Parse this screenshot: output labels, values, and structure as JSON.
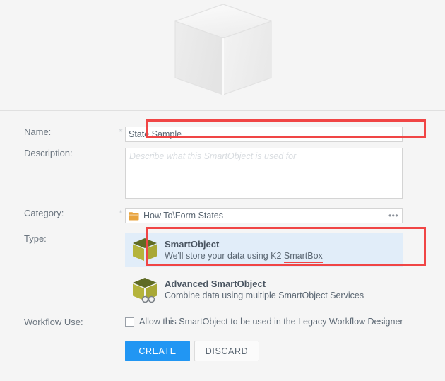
{
  "hero": {
    "icon": "smartobject-cube-icon"
  },
  "form": {
    "name": {
      "label": "Name:",
      "required_marker": "*",
      "value": "State Sample",
      "placeholder": ""
    },
    "description": {
      "label": "Description:",
      "value": "",
      "placeholder": "Describe what this SmartObject is used for"
    },
    "category": {
      "label": "Category:",
      "required_marker": "*",
      "value": "How To\\Form States",
      "folder_icon": "folder-icon",
      "browse_label": "•••"
    },
    "type": {
      "label": "Type:",
      "options": [
        {
          "title": "SmartObject",
          "description_prefix": "We'll store your data using K2 ",
          "description_highlight": "SmartBox",
          "icon": "cube-icon",
          "selected": true
        },
        {
          "title": "Advanced SmartObject",
          "description_prefix": "Combine data using multiple SmartObject Services",
          "description_highlight": "",
          "icon": "cube-glasses-icon",
          "selected": false
        }
      ]
    },
    "workflow_use": {
      "label": "Workflow Use:",
      "checkbox_label": "Allow this SmartObject to be used in the Legacy Workflow Designer",
      "checked": false
    },
    "buttons": {
      "create": "CREATE",
      "discard": "DISCARD"
    }
  },
  "annotations": {
    "name_box_color": "#f04545",
    "type_box_color": "#f04545",
    "smartbox_underline_color": "#f04545"
  },
  "colors": {
    "page_background": "#f5f5f5",
    "field_background": "#ffffff",
    "selected_option_background": "#e1edf9",
    "primary_button": "#2196f3",
    "label_text": "#6b757f",
    "cube_body": "#b5b43c",
    "cube_top": "#6d7a2e",
    "folder": "#e8a33d"
  }
}
